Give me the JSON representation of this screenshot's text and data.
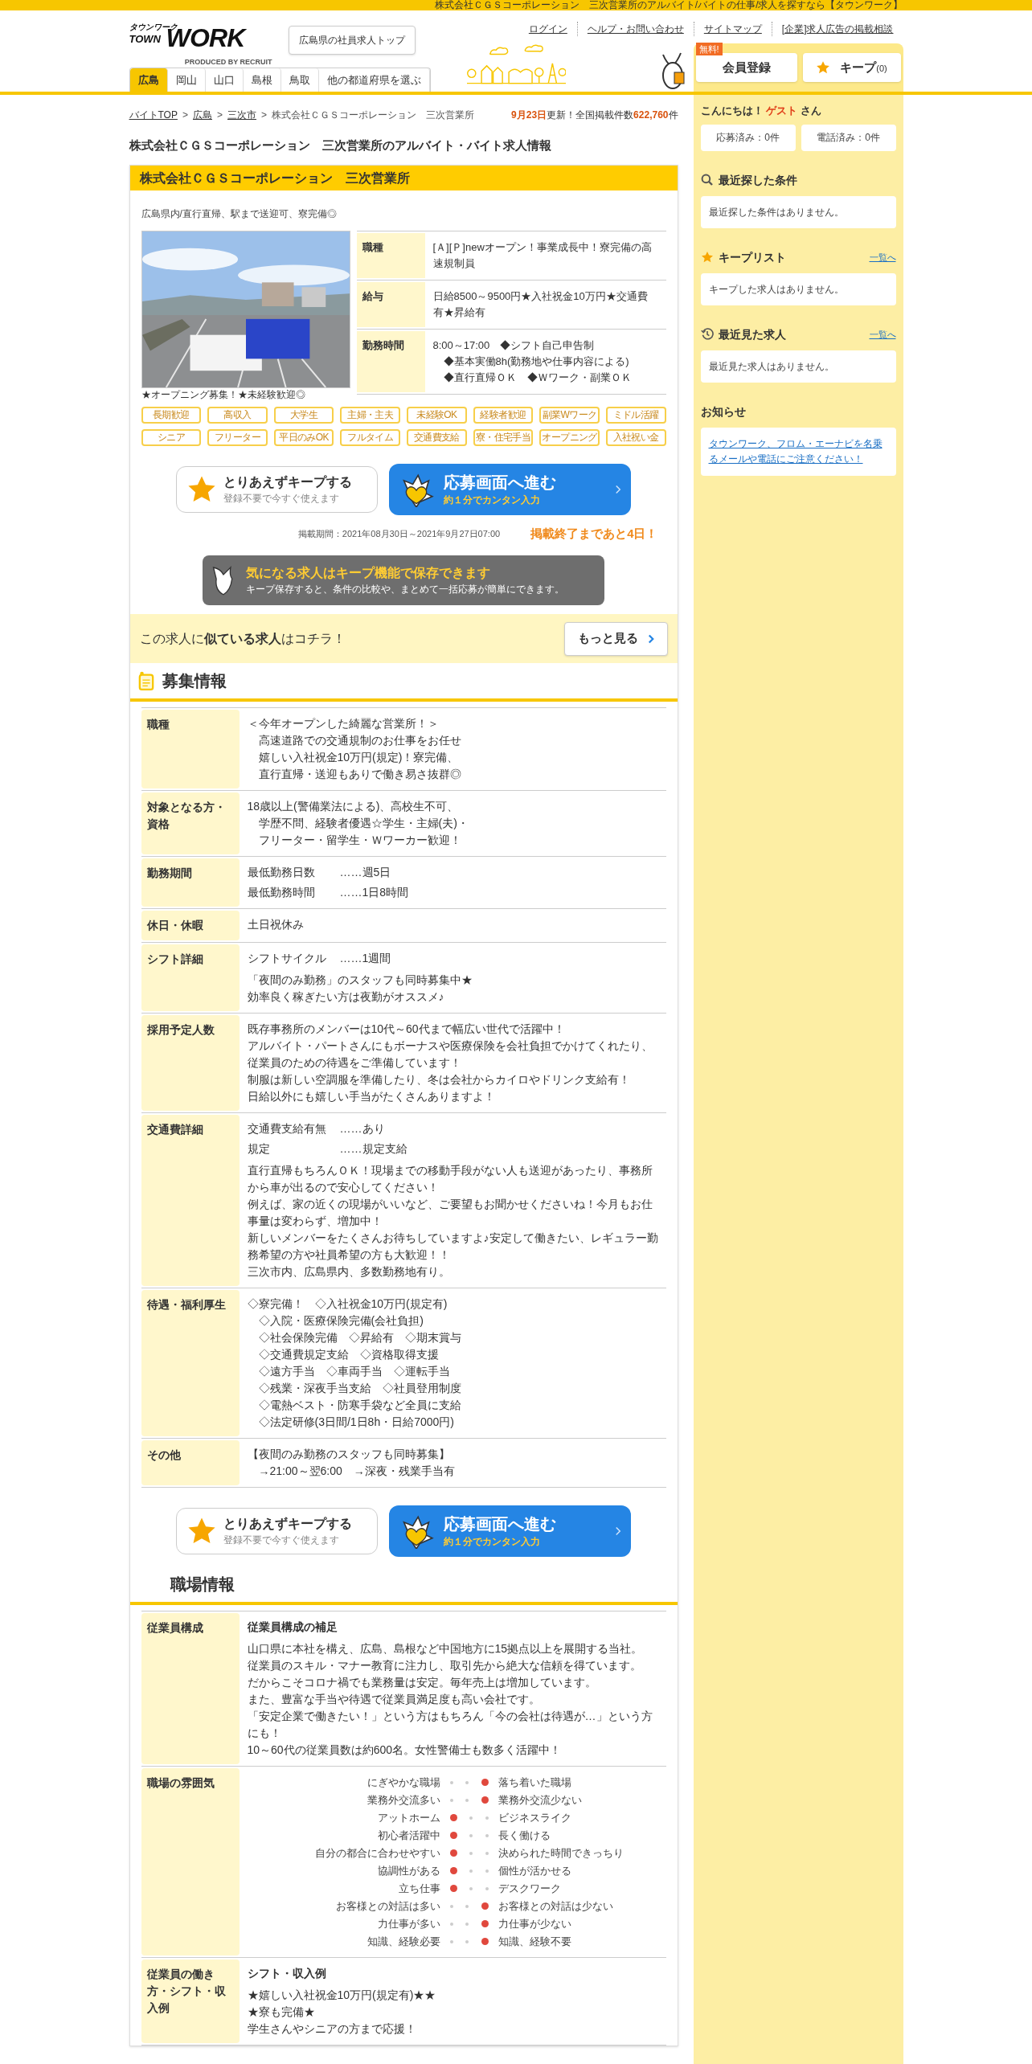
{
  "top_bar": {
    "text": "株式会社ＣＧＳコーポレーション　三次営業所のアルバイト/バイトの仕事/求人を探すなら【タウンワーク】"
  },
  "header": {
    "logo": {
      "kana": "タウンワーク",
      "word_1": "TOWN",
      "word_2": "WORK",
      "credit": "PRODUCED BY RECRUIT"
    },
    "prefecture_button": "広島県の社員求人トップ",
    "links": [
      "ログイン",
      "ヘルプ・お問い合わせ",
      "サイトマップ",
      "[企業]求人広告の掲載相談"
    ],
    "member_button": {
      "label": "会員登録",
      "badge": "無料!"
    },
    "keep_button": {
      "label": "キープ",
      "count": "(0)"
    },
    "region_tabs": [
      {
        "label": "広島",
        "selected": true
      },
      {
        "label": "岡山",
        "selected": false
      },
      {
        "label": "山口",
        "selected": false
      },
      {
        "label": "島根",
        "selected": false
      },
      {
        "label": "鳥取",
        "selected": false
      },
      {
        "label": "他の都道府県を選ぶ",
        "selected": false
      }
    ]
  },
  "breadcrumb": {
    "links": [
      "バイトTOP",
      "広島",
      "三次市"
    ],
    "separator": ">",
    "current": "株式会社ＣＧＳコーポレーション　三次営業所"
  },
  "update_info": {
    "date": "9月23日",
    "text": "更新！全国掲載件数",
    "count": "622,760",
    "unit": "件"
  },
  "page_title": "株式会社ＣＧＳコーポレーション　三次営業所のアルバイト・バイト求人情報",
  "job": {
    "company": "株式会社ＣＧＳコーポレーション　三次営業所",
    "catch": "広島県内/直行直帰、駅まで送迎可、寮完備◎",
    "photo": {
      "kind": "picture",
      "caption": "★オープニング募集！★未経験歓迎◎"
    },
    "summary": [
      {
        "label": "職種",
        "lines": [
          "[Ａ][Ｐ]newオープン！事業成長中！寮完備の高速規制員"
        ]
      },
      {
        "label": "給与",
        "lines": [
          "日給8500～9500円★入社祝金10万円★交通費有★昇給有"
        ]
      },
      {
        "label": "勤務時間",
        "lines": [
          "8:00～17:00　◆シフト自己申告制",
          "　◆基本実働8h(勤務地や仕事内容による)",
          "　◆直行直帰ＯＫ　◆Ｗワーク・副業ＯＫ"
        ]
      }
    ],
    "tags": [
      "長期歓迎",
      "高収入",
      "大学生",
      "主婦・主夫",
      "未経験OK",
      "経験者歓迎",
      "副業Wワーク",
      "ミドル活躍",
      "シニア",
      "フリーター",
      "平日のみOK",
      "フルタイム",
      "交通費支給",
      "寮・住宅手当",
      "オープニング",
      "入社祝い金"
    ],
    "actions": {
      "keep": {
        "title": "とりあえずキープする",
        "subtitle": "登録不要で今すぐ使えます"
      },
      "apply": {
        "title": "応募画面へ進む",
        "subtitle": "約１分でカンタン入力"
      }
    },
    "period": "掲載期間：2021年08月30日～2021年9月27日07:00",
    "remaining": "掲載終了まであと4日！",
    "keep_banner": {
      "title": "気になる求人はキープ機能で保存できます",
      "text": "キープ保存すると、条件の比較や、まとめて一括応募が簡単にできます。"
    },
    "similar": {
      "text": "この求人に**似ている求人**はコチラ！",
      "button": "もっと見る"
    }
  },
  "recruit_section": {
    "heading": "募集情報",
    "rows": [
      {
        "label": "職種",
        "blocks": [
          {
            "kind": "text",
            "lines": [
              "＜今年オープンした綺麗な営業所！＞",
              "　高速道路での交通規制のお仕事をお任せ",
              "　嬉しい入社祝金10万円(規定)！寮完備、",
              "　直行直帰・送迎もありで働き易さ抜群◎"
            ]
          }
        ]
      },
      {
        "label": "対象となる方・資格",
        "blocks": [
          {
            "kind": "text",
            "lines": [
              "18歳以上(警備業法による)、高校生不可、",
              "　学歴不問、経験者優遇☆学生・主婦(夫)・",
              "　フリーター・留学生・Ｗワーカー歓迎！"
            ]
          }
        ]
      },
      {
        "label": "勤務期間",
        "blocks": [
          {
            "kind": "pairs",
            "items": [
              {
                "key": "最低勤務日数",
                "value": "……週5日"
              },
              {
                "key": "最低勤務時間",
                "value": "……1日8時間"
              }
            ]
          }
        ]
      },
      {
        "label": "休日・休暇",
        "blocks": [
          {
            "kind": "text",
            "lines": [
              "土日祝休み"
            ]
          }
        ]
      },
      {
        "label": "シフト詳細",
        "blocks": [
          {
            "kind": "pairs",
            "items": [
              {
                "key": "シフトサイクル",
                "value": "……1週間"
              }
            ]
          },
          {
            "kind": "text",
            "lines": [
              "「夜間のみ勤務」のスタッフも同時募集中★",
              "効率良く稼ぎたい方は夜勤がオススメ♪"
            ]
          }
        ]
      },
      {
        "label": "採用予定人数",
        "blocks": [
          {
            "kind": "text",
            "lines": [
              "既存事務所のメンバーは10代～60代まで幅広い世代で活躍中！",
              "アルバイト・パートさんにもボーナスや医療保険を会社負担でかけてくれたり、",
              "従業員のための待遇をご準備しています！",
              "制服は新しい空調服を準備したり、冬は会社からカイロやドリンク支給有！",
              "日給以外にも嬉しい手当がたくさんありますよ！"
            ]
          }
        ]
      },
      {
        "label": "交通費詳細",
        "blocks": [
          {
            "kind": "pairs",
            "items": [
              {
                "key": "交通費支給有無",
                "value": "……あり"
              },
              {
                "key": "規定",
                "value": "……規定支給"
              }
            ]
          },
          {
            "kind": "text",
            "lines": [
              "直行直帰もちろんＯＫ！現場までの移動手段がない人も送迎があったり、事務所から車が出るので安心してください！",
              "例えば、家の近くの現場がいいなど、ご要望もお聞かせくださいね！今月もお仕事量は変わらず、増加中！",
              "新しいメンバーをたくさんお待ちしていますよ♪安定して働きたい、レギュラー勤務希望の方や社員希望の方も大歓迎！！",
              "三次市内、広島県内、多数勤務地有り。"
            ]
          }
        ]
      },
      {
        "label": "待遇・福利厚生",
        "blocks": [
          {
            "kind": "text",
            "lines": [
              "◇寮完備！　◇入社祝金10万円(規定有)",
              "　◇入院・医療保険完備(会社負担)",
              "　◇社会保険完備　◇昇給有　◇期末賞与",
              "　◇交通費規定支給　◇資格取得支援",
              "　◇遠方手当　◇車両手当　◇運転手当",
              "　◇残業・深夜手当支給　◇社員登用制度",
              "　◇電熱ベスト・防寒手袋など全員に支給",
              "　◇法定研修(3日間/1日8h・日給7000円)"
            ]
          }
        ]
      },
      {
        "label": "その他",
        "blocks": [
          {
            "kind": "text",
            "lines": [
              "【夜間のみ勤務のスタッフも同時募集】",
              "　→21:00～翌6:00　→深夜・残業手当有"
            ]
          }
        ]
      }
    ],
    "actions": {
      "keep": {
        "title": "とりあえずキープする",
        "subtitle": "登録不要で今すぐ使えます"
      },
      "apply": {
        "title": "応募画面へ進む",
        "subtitle": "約１分でカンタン入力"
      }
    }
  },
  "workplace_section": {
    "heading": "職場情報",
    "rows": [
      {
        "label": "従業員構成",
        "blocks": [
          {
            "kind": "heading",
            "text": "従業員構成の補足"
          },
          {
            "kind": "text",
            "lines": [
              "山口県に本社を構え、広島、島根など中国地方に15拠点以上を展開する当社。",
              "従業員のスキル・マナー教育に注力し、取引先から絶大な信頼を得ています。",
              "だからこそコロナ禍でも業務量は安定。毎年売上は増加しています。",
              "また、豊富な手当や待遇で従業員満足度も高い会社です。",
              "「安定企業で働きたい！」という方はもちろん「今の会社は待遇が…」という方にも！",
              "10～60代の従業員数は約600名。女性警備士も数多く活躍中！"
            ]
          }
        ]
      },
      {
        "label": "職場の雰囲気",
        "blocks": [
          {
            "kind": "scale",
            "items": [
              {
                "left": "にぎやかな職場",
                "right": "落ち着いた職場",
                "dots": [
                  {
                    "selected": false
                  },
                  {
                    "selected": false
                  },
                  {
                    "selected": true
                  }
                ]
              },
              {
                "left": "業務外交流多い",
                "right": "業務外交流少ない",
                "dots": [
                  {
                    "selected": false
                  },
                  {
                    "selected": false
                  },
                  {
                    "selected": true
                  }
                ]
              },
              {
                "left": "アットホーム",
                "right": "ビジネスライク",
                "dots": [
                  {
                    "selected": true
                  },
                  {
                    "selected": false
                  },
                  {
                    "selected": false
                  }
                ]
              },
              {
                "left": "初心者活躍中",
                "right": "長く働ける",
                "dots": [
                  {
                    "selected": true
                  },
                  {
                    "selected": false
                  },
                  {
                    "selected": false
                  }
                ]
              },
              {
                "left": "自分の都合に合わせやすい",
                "right": "決められた時間できっちり",
                "dots": [
                  {
                    "selected": true
                  },
                  {
                    "selected": false
                  },
                  {
                    "selected": false
                  }
                ]
              },
              {
                "left": "協調性がある",
                "right": "個性が活かせる",
                "dots": [
                  {
                    "selected": true
                  },
                  {
                    "selected": false
                  },
                  {
                    "selected": false
                  }
                ]
              },
              {
                "left": "立ち仕事",
                "right": "デスクワーク",
                "dots": [
                  {
                    "selected": true
                  },
                  {
                    "selected": false
                  },
                  {
                    "selected": false
                  }
                ]
              },
              {
                "left": "お客様との対話は多い",
                "right": "お客様との対話は少ない",
                "dots": [
                  {
                    "selected": false
                  },
                  {
                    "selected": false
                  },
                  {
                    "selected": true
                  }
                ]
              },
              {
                "left": "力仕事が多い",
                "right": "力仕事が少ない",
                "dots": [
                  {
                    "selected": false
                  },
                  {
                    "selected": false
                  },
                  {
                    "selected": true
                  }
                ]
              },
              {
                "left": "知識、経験必要",
                "right": "知識、経験不要",
                "dots": [
                  {
                    "selected": false
                  },
                  {
                    "selected": false
                  },
                  {
                    "selected": true
                  }
                ]
              }
            ]
          }
        ]
      },
      {
        "label": "従業員の働き方・シフト・収入例",
        "blocks": [
          {
            "kind": "heading",
            "text": "シフト・収入例"
          },
          {
            "kind": "text",
            "lines": [
              "★嬉しい入社祝金10万円(規定有)★★",
              "★寮も完備★",
              "学生さんやシニアの方まで応援！"
            ]
          }
        ]
      }
    ]
  },
  "sidebar": {
    "greeting": {
      "prefix": "こんにちは！",
      "name": "ゲスト",
      "suffix": "さん"
    },
    "counts": [
      "応募済み：0件",
      "電話済み：0件"
    ],
    "sections": [
      {
        "kind": "search",
        "title": "最近探した条件",
        "message": "最近探した条件はありません。"
      },
      {
        "kind": "keep",
        "title": "キープリスト",
        "link": "一覧へ",
        "message": "キープした求人はありません。"
      },
      {
        "kind": "history",
        "title": "最近見た求人",
        "link": "一覧へ",
        "message": "最近見た求人はありません。"
      },
      {
        "kind": "notice",
        "title": "お知らせ",
        "notice_link": "タウンワーク、フロム・エーナビを名乗るメールや電話にご注意ください！"
      }
    ]
  }
}
